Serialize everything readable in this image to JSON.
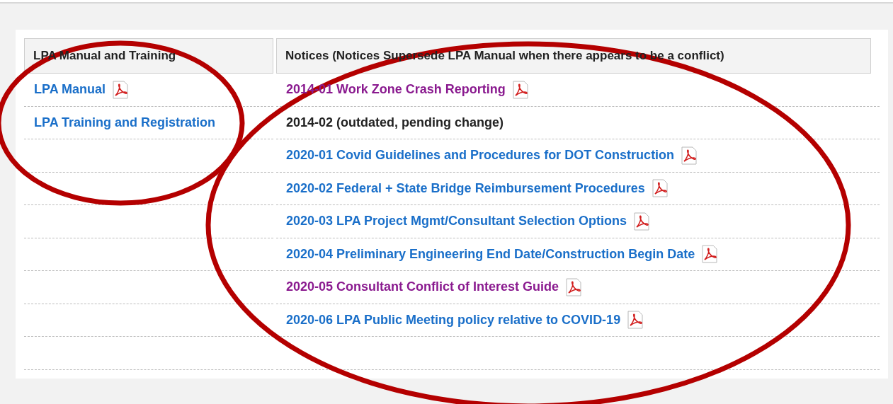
{
  "left_column": {
    "heading": "LPA Manual and Training",
    "links": [
      {
        "label": "LPA Manual",
        "visited": false,
        "pdf": true
      },
      {
        "label": "LPA Training and Registration",
        "visited": false,
        "pdf": false
      }
    ]
  },
  "right_column": {
    "heading": "Notices (Notices Supersede LPA Manual when there appears to be a conflict)",
    "rows": [
      {
        "kind": "link",
        "label": "2014-01 Work Zone Crash Reporting",
        "visited": true,
        "pdf": true
      },
      {
        "kind": "text",
        "label": "2014-02 (outdated, pending change)",
        "pdf": false
      },
      {
        "kind": "link",
        "label": "2020-01 Covid Guidelines and Procedures for DOT Construction",
        "visited": false,
        "pdf": true
      },
      {
        "kind": "link",
        "label": "2020-02 Federal + State Bridge Reimbursement Procedures",
        "visited": false,
        "pdf": true
      },
      {
        "kind": "link",
        "label": "2020-03 LPA Project Mgmt/Consultant Selection Options",
        "visited": false,
        "pdf": true
      },
      {
        "kind": "link",
        "label": "2020-04 Preliminary Engineering End Date/Construction Begin Date",
        "visited": false,
        "pdf": true
      },
      {
        "kind": "link",
        "label": "2020-05 Consultant Conflict of Interest Guide",
        "visited": true,
        "pdf": true
      },
      {
        "kind": "link",
        "label": "2020-06 LPA Public Meeting policy relative to COVID-19",
        "visited": false,
        "pdf": true
      }
    ]
  }
}
